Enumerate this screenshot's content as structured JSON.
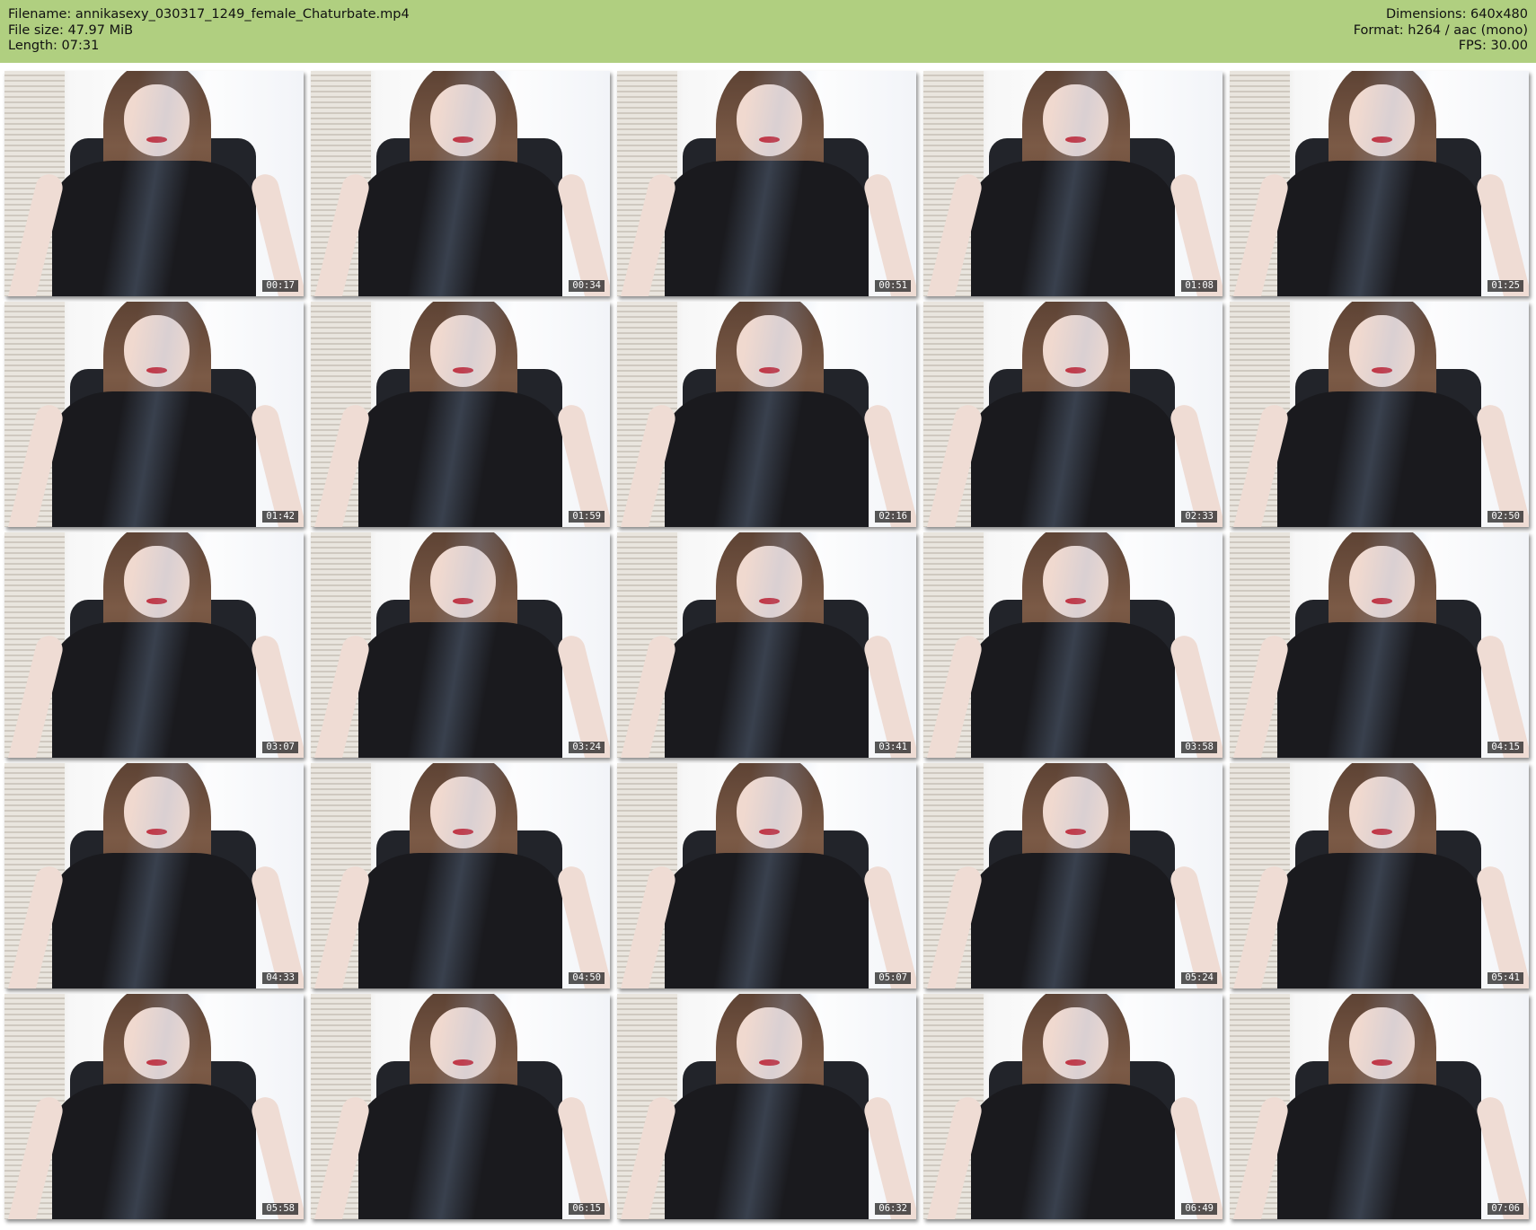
{
  "header": {
    "filename": "Filename: annikasexy_030317_1249_female_Chaturbate.mp4",
    "filesize": "File size: 47.97 MiB",
    "length": "Length: 07:31",
    "dimensions": "Dimensions: 640x480",
    "format": "Format: h264 / aac (mono)",
    "fps": "FPS: 30.00"
  },
  "colors": {
    "header_bg": "#b0cf80"
  },
  "thumbnails": [
    {
      "time": "00:17"
    },
    {
      "time": "00:34"
    },
    {
      "time": "00:51"
    },
    {
      "time": "01:08"
    },
    {
      "time": "01:25"
    },
    {
      "time": "01:42"
    },
    {
      "time": "01:59"
    },
    {
      "time": "02:16"
    },
    {
      "time": "02:33"
    },
    {
      "time": "02:50"
    },
    {
      "time": "03:07"
    },
    {
      "time": "03:24"
    },
    {
      "time": "03:41"
    },
    {
      "time": "03:58"
    },
    {
      "time": "04:15"
    },
    {
      "time": "04:33"
    },
    {
      "time": "04:50"
    },
    {
      "time": "05:07"
    },
    {
      "time": "05:24"
    },
    {
      "time": "05:41"
    },
    {
      "time": "05:58"
    },
    {
      "time": "06:15"
    },
    {
      "time": "06:32"
    },
    {
      "time": "06:49"
    },
    {
      "time": "07:06"
    }
  ]
}
